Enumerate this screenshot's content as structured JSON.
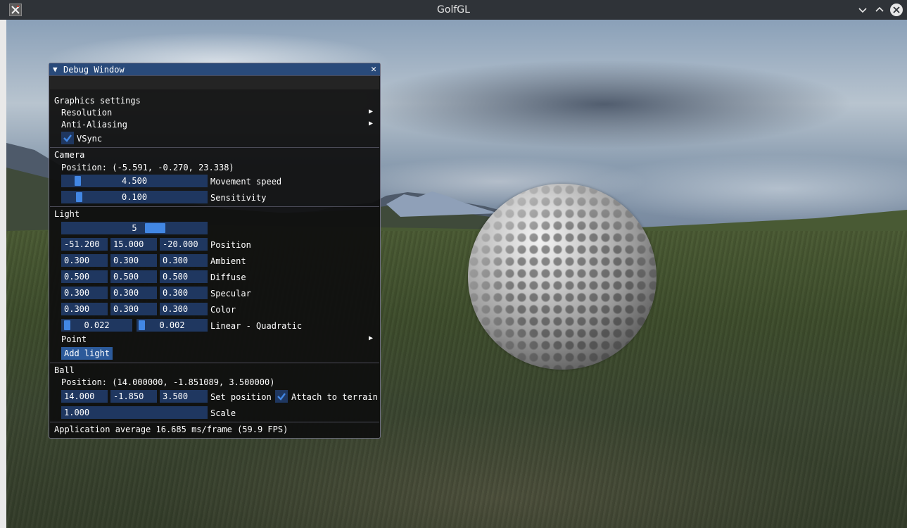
{
  "window": {
    "title": "GolfGL",
    "app_icon": "x-app-icon",
    "buttons": [
      "minimize-icon",
      "maximize-icon",
      "close-icon"
    ]
  },
  "scene": {
    "description_objects": [
      "sky",
      "mountains",
      "grass-terrain",
      "golf-ball"
    ]
  },
  "debug": {
    "title": "Debug Window",
    "graphics": {
      "header": "Graphics settings",
      "resolution": "Resolution",
      "anti_aliasing": "Anti-Aliasing",
      "vsync_label": "VSync",
      "vsync": true
    },
    "camera": {
      "header": "Camera",
      "position": "Position: (-5.591, -0.270, 23.338)",
      "movement_speed_value": "4.500",
      "movement_speed_label": "Movement speed",
      "sensitivity_value": "0.100",
      "sensitivity_label": "Sensitivity"
    },
    "light": {
      "header": "Light",
      "index_value": "5",
      "position": {
        "x": "-51.200",
        "y": "15.000",
        "z": "-20.000",
        "label": "Position"
      },
      "ambient": {
        "r": "0.300",
        "g": "0.300",
        "b": "0.300",
        "label": "Ambient"
      },
      "diffuse": {
        "r": "0.500",
        "g": "0.500",
        "b": "0.500",
        "label": "Diffuse"
      },
      "specular": {
        "r": "0.300",
        "g": "0.300",
        "b": "0.300",
        "label": "Specular"
      },
      "color": {
        "r": "0.300",
        "g": "0.300",
        "b": "0.300",
        "label": "Color"
      },
      "linear": "0.022",
      "quadratic": "0.002",
      "attenuation_label": "Linear - Quadratic",
      "point_label": "Point",
      "add_light": "Add light"
    },
    "ball": {
      "header": "Ball",
      "position": "Position: (14.000000, -1.851089, 3.500000)",
      "x": "14.000",
      "y": "-1.850",
      "z": "3.500",
      "set_position_label": "Set position",
      "attach_label": "Attach to terrain",
      "attach": true,
      "scale_value": "1.000",
      "scale_label": "Scale"
    },
    "footer": "Application average 16.685 ms/frame (59.9 FPS)"
  },
  "colors": {
    "title_bar": "#2f3338",
    "debug_bg": "#0f0f0f",
    "debug_title": "#294a7a",
    "field_bg": "#1f3760",
    "accent": "#4287e4"
  }
}
